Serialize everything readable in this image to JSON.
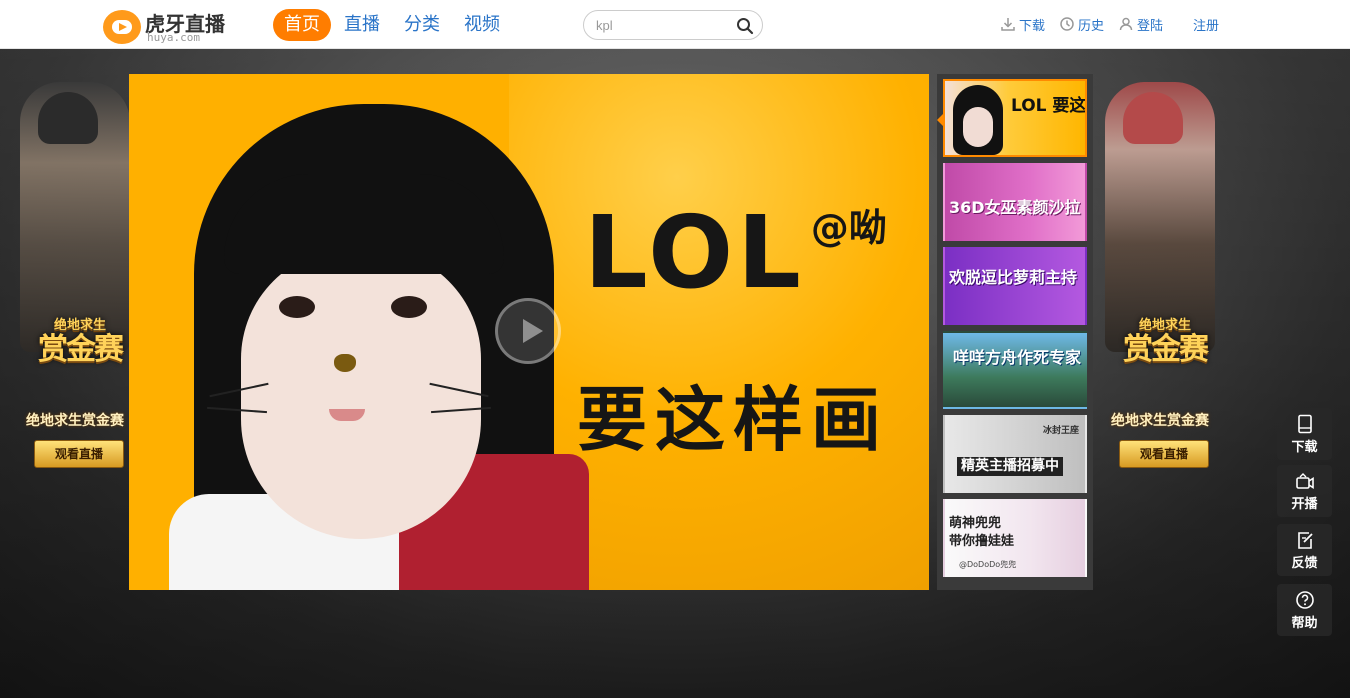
{
  "header": {
    "logo_cn": "虎牙直播",
    "logo_en": "huya.com",
    "nav": [
      {
        "label": "首页",
        "active": true
      },
      {
        "label": "直播",
        "active": false
      },
      {
        "label": "分类",
        "active": false
      },
      {
        "label": "视频",
        "active": false
      }
    ],
    "search": {
      "value": "kpl",
      "icon": "search-icon"
    },
    "user_links": {
      "download": "下载",
      "history": "历史",
      "login": "登陆",
      "register": "注册"
    },
    "accent": "#ff7d00",
    "link_color": "#2a74c8"
  },
  "side_banners": {
    "medal_line1": "绝地求生",
    "medal_line2": "赏金赛",
    "subtitle": "绝地求生赏金赛",
    "button": "观看直播"
  },
  "player": {
    "title": "LOL",
    "title_suffix": "@呦",
    "subtitle": "要这样画",
    "background": "#ffb000"
  },
  "thumbnails": [
    {
      "text": "LOL 要这样画",
      "active": true
    },
    {
      "text": "36D女巫素颜沙拉"
    },
    {
      "text": "欢脱逗比萝莉主持"
    },
    {
      "text": "咩咩方舟作死专家"
    },
    {
      "text": "精英主播招募中",
      "tag": "冰封王座"
    },
    {
      "text": "萌神兜兜\n带你撸娃娃",
      "sub": "@DoDoDo兜兜"
    }
  ],
  "float_toolbar": [
    {
      "label": "下载",
      "icon": "tablet-icon"
    },
    {
      "label": "开播",
      "icon": "camera-icon"
    },
    {
      "label": "反馈",
      "icon": "edit-icon"
    },
    {
      "label": "帮助",
      "icon": "help-icon"
    }
  ]
}
